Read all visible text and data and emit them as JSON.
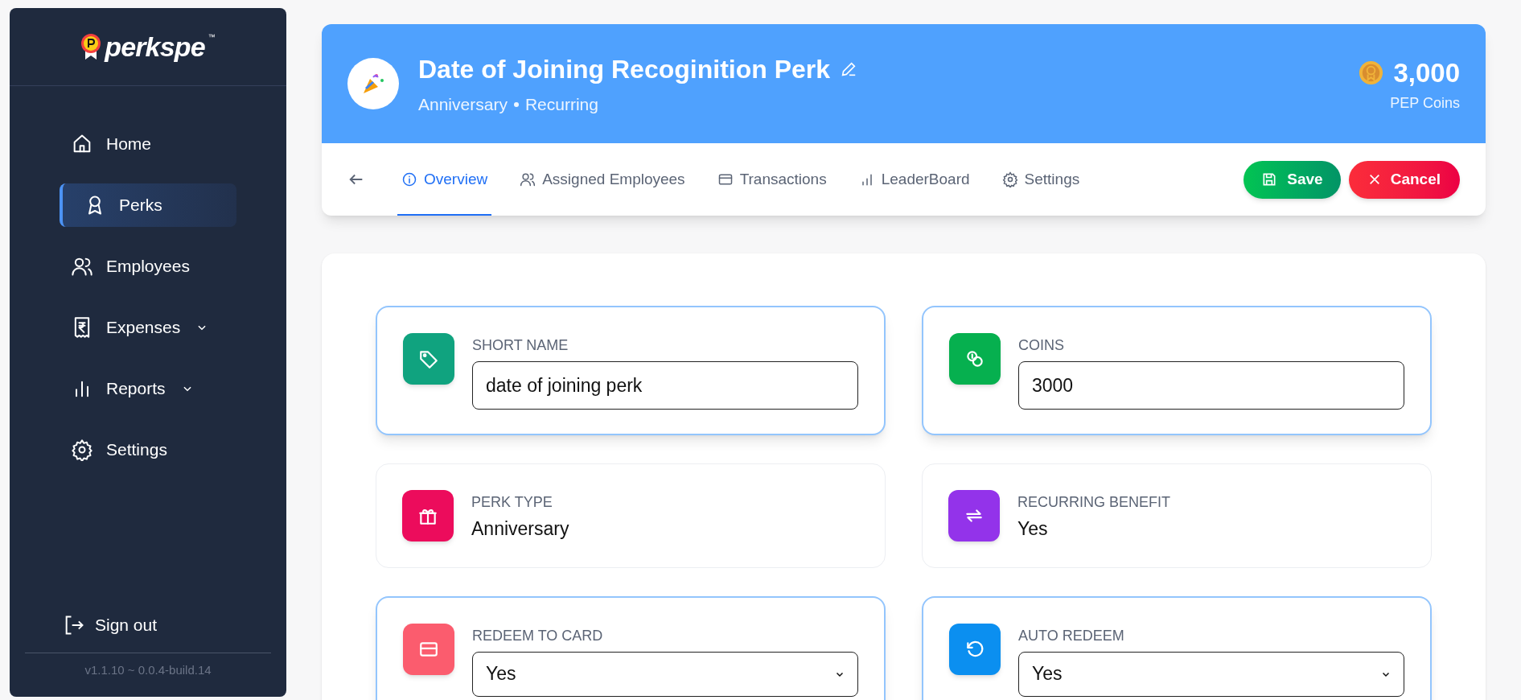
{
  "sidebar": {
    "logo_text": "perkspe",
    "logo_mark": "™",
    "items": [
      {
        "label": "Home",
        "selected": false,
        "expandable": false
      },
      {
        "label": "Perks",
        "selected": true,
        "expandable": false
      },
      {
        "label": "Employees",
        "selected": false,
        "expandable": false
      },
      {
        "label": "Expenses",
        "selected": false,
        "expandable": true
      },
      {
        "label": "Reports",
        "selected": false,
        "expandable": true
      },
      {
        "label": "Settings",
        "selected": false,
        "expandable": false
      }
    ],
    "sign_out": "Sign out",
    "version": "v1.1.10 ~ 0.0.4-build.14"
  },
  "header": {
    "title": "Date of Joining Recoginition Perk",
    "subtitle_type": "Anniversary",
    "subtitle_frequency": "Recurring",
    "coins": "3,000",
    "coins_label": "PEP Coins"
  },
  "tabs": [
    {
      "label": "Overview",
      "selected": true
    },
    {
      "label": "Assigned Employees",
      "selected": false
    },
    {
      "label": "Transactions",
      "selected": false
    },
    {
      "label": "LeaderBoard",
      "selected": false
    },
    {
      "label": "Settings",
      "selected": false
    }
  ],
  "buttons": {
    "save": "Save",
    "cancel": "Cancel"
  },
  "fields": [
    {
      "kind": "input",
      "label": "SHORT NAME",
      "value": "date of joining perk",
      "color": "#10a37f"
    },
    {
      "kind": "input",
      "label": "COINS",
      "value": "3000",
      "color": "#06b04f"
    },
    {
      "kind": "text",
      "label": "PERK TYPE",
      "value": "Anniversary",
      "color": "#ec0c5c"
    },
    {
      "kind": "text",
      "label": "RECURRING BENEFIT",
      "value": "Yes",
      "color": "#9333ea"
    },
    {
      "kind": "select",
      "label": "REDEEM TO CARD",
      "value": "Yes",
      "color": "#fb5c6e"
    },
    {
      "kind": "select",
      "label": "AUTO REDEEM",
      "value": "Yes",
      "color": "#0b8ff0"
    }
  ]
}
